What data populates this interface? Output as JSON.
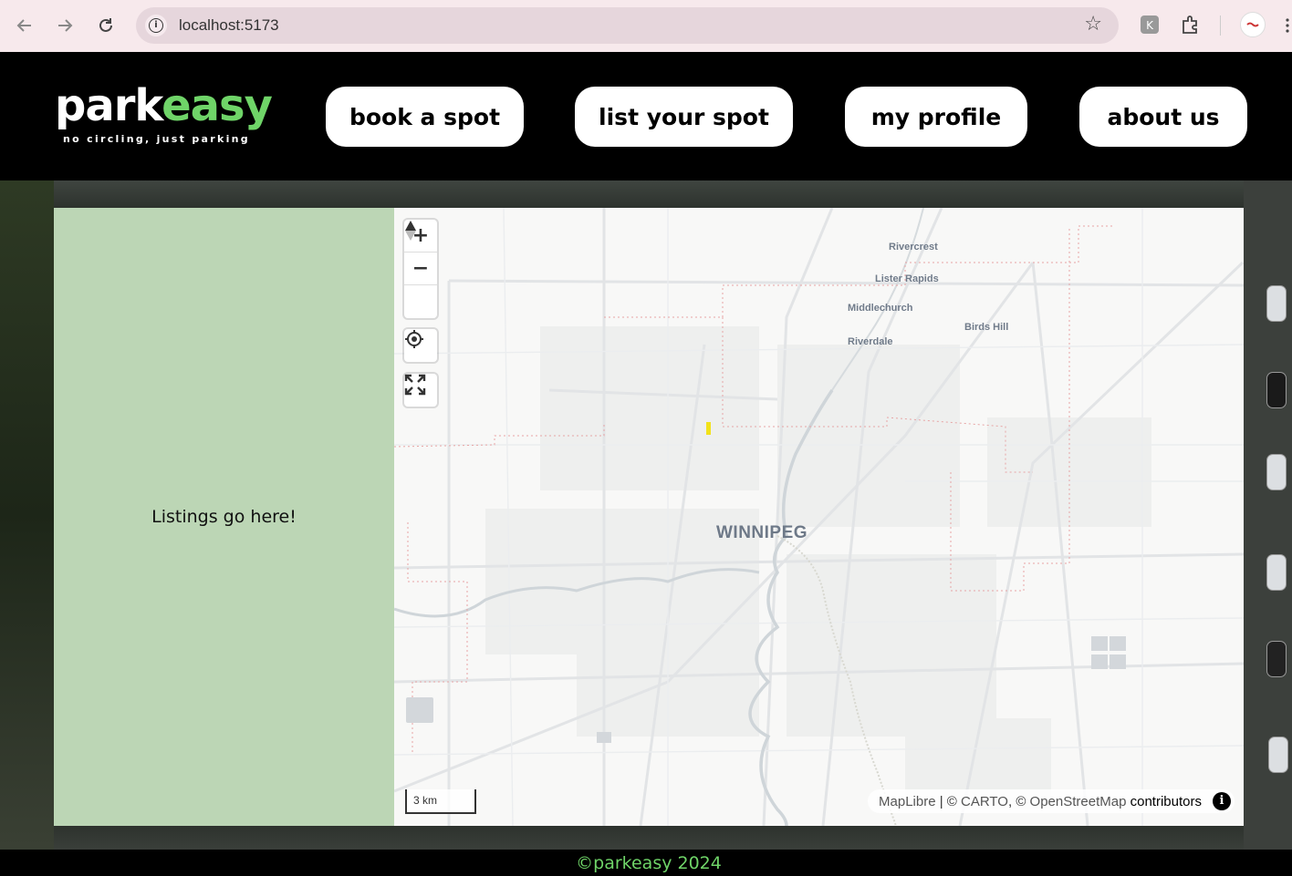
{
  "browser": {
    "url": "localhost:5173"
  },
  "header": {
    "logo_park": "park",
    "logo_easy": "easy",
    "tagline": "no circling, just parking",
    "nav": [
      {
        "label": "book a spot"
      },
      {
        "label": "list your spot"
      },
      {
        "label": "my profile"
      },
      {
        "label": "about us"
      }
    ]
  },
  "listings": {
    "placeholder": "Listings go here!"
  },
  "map": {
    "city_label": "WINNIPEG",
    "place_labels": [
      "Rivercrest",
      "Lister Rapids",
      "Middlechurch",
      "Birds Hill",
      "Riverdale"
    ],
    "controls": {
      "zoom_in": "+",
      "zoom_out": "−",
      "compass": "▲",
      "geolocate_icon": "crosshair-icon",
      "fullscreen_icon": "fullscreen-icon"
    },
    "scale_label": "3 km",
    "attribution": {
      "maplibre": "MapLibre",
      "sep1": " | © ",
      "carto": "CARTO",
      "sep2": ", © ",
      "osm": "OpenStreetMap",
      "contributors": " contributors",
      "info_icon": "i"
    }
  },
  "footer": {
    "text": "©parkeasy 2024"
  },
  "colors": {
    "brand_green": "#6fd468",
    "listings_bg": "#bcd6b5",
    "header_bg": "#000000",
    "marker": "#f2e21a"
  }
}
